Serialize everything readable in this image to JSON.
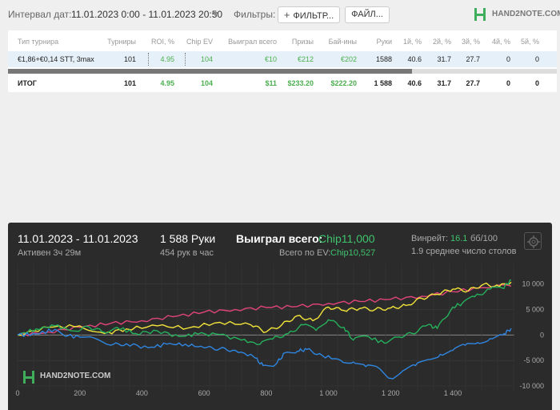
{
  "topbar": {
    "interval_label": "Интервал дат:",
    "interval_value": "11.01.2023 0:00 - 11.01.2023 20:50",
    "filters_label": "Фильтры:",
    "filter_button": "ФИЛЬТР...",
    "file_button": "ФАЙЛ...",
    "logo_text": "HAND2NOTE.COM"
  },
  "table": {
    "headers": [
      "Тип турнира",
      "Турниры",
      "ROI, %",
      "Chip EV",
      "Выиграл всего",
      "Призы",
      "Бай-ины",
      "Руки",
      "1й, %",
      "2й, %",
      "3й, %",
      "4й, %",
      "5й, %"
    ],
    "row": [
      "€1,86+€0,14 STT, 3max",
      "101",
      "4.95",
      "104",
      "€10",
      "€212",
      "€202",
      "1588",
      "40.6",
      "31.7",
      "27.7",
      "0",
      "0"
    ],
    "total": [
      "ИТОГ",
      "101",
      "4.95",
      "104",
      "$11",
      "$233.20",
      "$222.20",
      "1 588",
      "40.6",
      "31.7",
      "27.7",
      "0",
      "0"
    ]
  },
  "panel": {
    "date_range": "11.01.2023 - 11.01.2023",
    "active": "Активен 3ч 29м",
    "hands": "1 588 Руки",
    "hands_per_hour": "454 рук в час",
    "won_label": "Выиграл всего:",
    "won_value": "Chip11,000",
    "ev_label": "Всего по EV:",
    "ev_value": "Chip10,527",
    "winrate_label": "Винрейт:",
    "winrate_value": "16.1",
    "winrate_unit": "бб/100",
    "avg_tables": "1.9 среднее число столов",
    "watermark": "HAND2NOTE.COM"
  },
  "colors": {
    "green": "#3fc36c",
    "pink": "#e0447a",
    "yellow": "#f2e43a",
    "green_line": "#25b05c",
    "blue": "#2f86e0",
    "panel_bg": "#2b2b2b"
  },
  "chart_data": {
    "type": "line",
    "x_ticks": [
      "0",
      "200",
      "400",
      "600",
      "800",
      "1 000",
      "1 200",
      "1 400"
    ],
    "y_ticks": [
      "10 000",
      "5 000",
      "0",
      "-5 000",
      "-10 000"
    ],
    "xlim": [
      0,
      1588
    ],
    "ylim": [
      -10000,
      12000
    ],
    "series": [
      {
        "color": "#e0447a",
        "points": [
          [
            0,
            0
          ],
          [
            100,
            600
          ],
          [
            200,
            1500
          ],
          [
            300,
            2300
          ],
          [
            400,
            2800
          ],
          [
            500,
            3600
          ],
          [
            600,
            4500
          ],
          [
            700,
            5000
          ],
          [
            800,
            5400
          ],
          [
            900,
            5600
          ],
          [
            1000,
            6200
          ],
          [
            1100,
            6600
          ],
          [
            1200,
            7000
          ],
          [
            1300,
            7600
          ],
          [
            1400,
            8500
          ],
          [
            1500,
            9300
          ],
          [
            1588,
            9600
          ]
        ]
      },
      {
        "color": "#f2e43a",
        "points": [
          [
            0,
            0
          ],
          [
            100,
            1500
          ],
          [
            200,
            1800
          ],
          [
            280,
            300
          ],
          [
            350,
            1200
          ],
          [
            450,
            1800
          ],
          [
            550,
            1400
          ],
          [
            650,
            2500
          ],
          [
            750,
            2000
          ],
          [
            800,
            600
          ],
          [
            850,
            2000
          ],
          [
            900,
            3800
          ],
          [
            950,
            2800
          ],
          [
            1000,
            5500
          ],
          [
            1050,
            4800
          ],
          [
            1100,
            5200
          ],
          [
            1150,
            5000
          ],
          [
            1200,
            5300
          ],
          [
            1250,
            5800
          ],
          [
            1300,
            7200
          ],
          [
            1350,
            8000
          ],
          [
            1400,
            9000
          ],
          [
            1450,
            8700
          ],
          [
            1500,
            10000
          ],
          [
            1550,
            9500
          ],
          [
            1588,
            10400
          ]
        ]
      },
      {
        "color": "#25b05c",
        "points": [
          [
            0,
            0
          ],
          [
            60,
            1200
          ],
          [
            120,
            1800
          ],
          [
            180,
            800
          ],
          [
            230,
            1600
          ],
          [
            280,
            500
          ],
          [
            320,
            1500
          ],
          [
            380,
            300
          ],
          [
            450,
            800
          ],
          [
            520,
            -300
          ],
          [
            580,
            200
          ],
          [
            650,
            100
          ],
          [
            720,
            -1000
          ],
          [
            780,
            -1800
          ],
          [
            820,
            -800
          ],
          [
            870,
            300
          ],
          [
            920,
            2000
          ],
          [
            960,
            900
          ],
          [
            1000,
            3000
          ],
          [
            1050,
            1500
          ],
          [
            1080,
            -1000
          ],
          [
            1120,
            -200
          ],
          [
            1180,
            -1600
          ],
          [
            1220,
            -400
          ],
          [
            1270,
            300
          ],
          [
            1320,
            2000
          ],
          [
            1350,
            1300
          ],
          [
            1400,
            5500
          ],
          [
            1430,
            6200
          ],
          [
            1470,
            7500
          ],
          [
            1520,
            9000
          ],
          [
            1560,
            9200
          ],
          [
            1588,
            10800
          ]
        ]
      },
      {
        "color": "#2f86e0",
        "points": [
          [
            0,
            0
          ],
          [
            60,
            200
          ],
          [
            120,
            1100
          ],
          [
            160,
            -200
          ],
          [
            220,
            -400
          ],
          [
            300,
            -2000
          ],
          [
            350,
            -1700
          ],
          [
            420,
            -2500
          ],
          [
            480,
            -1800
          ],
          [
            540,
            -1800
          ],
          [
            600,
            -2500
          ],
          [
            650,
            -2700
          ],
          [
            700,
            -3000
          ],
          [
            760,
            -4300
          ],
          [
            790,
            -6000
          ],
          [
            830,
            -5800
          ],
          [
            860,
            -3500
          ],
          [
            900,
            -3200
          ],
          [
            930,
            -2800
          ],
          [
            980,
            -4000
          ],
          [
            1040,
            -5000
          ],
          [
            1080,
            -5300
          ],
          [
            1120,
            -6200
          ],
          [
            1160,
            -6400
          ],
          [
            1200,
            -8500
          ],
          [
            1240,
            -7000
          ],
          [
            1280,
            -6000
          ],
          [
            1320,
            -4800
          ],
          [
            1360,
            -3800
          ],
          [
            1400,
            -3000
          ],
          [
            1440,
            -2000
          ],
          [
            1480,
            -1500
          ],
          [
            1520,
            -700
          ],
          [
            1560,
            0
          ],
          [
            1588,
            1300
          ]
        ]
      }
    ]
  }
}
